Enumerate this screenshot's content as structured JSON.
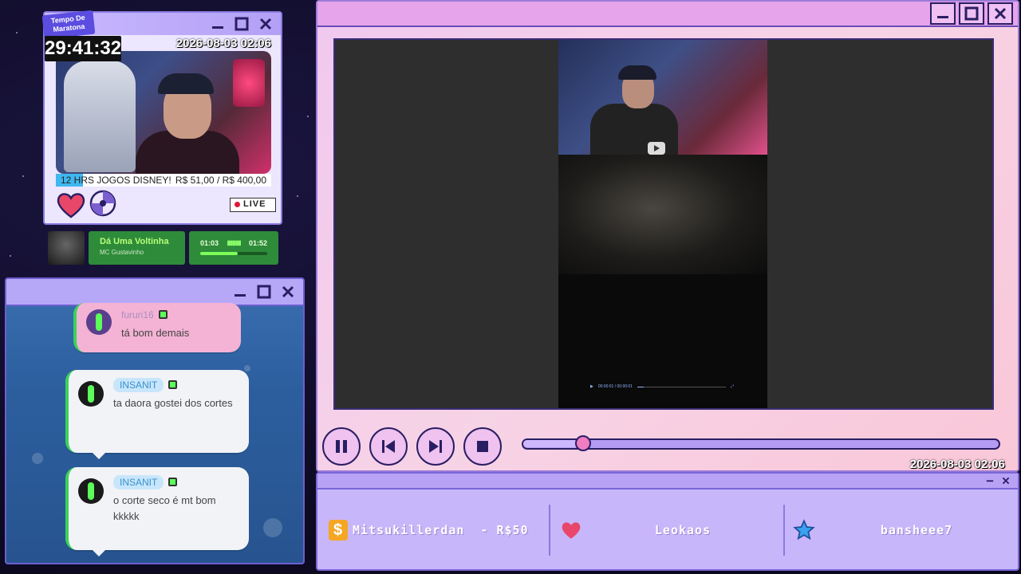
{
  "webcam": {
    "marathon_label": "Tempo De Maratona",
    "marathon_time": "29:41:32",
    "datetime": "2026-08-03 02:06",
    "goal_title": "12 HRS JOGOS DISNEY!",
    "goal_amount": "R$ 51,00 / R$ 400,00",
    "goal_progress": 0.1275,
    "live_label": "LIVE"
  },
  "music": {
    "title": "Dá Uma Voltinha",
    "artist": "MC Gustavinho",
    "current_time": "01:03",
    "total_time": "01:52",
    "progress": 0.56
  },
  "chat": {
    "messages": [
      {
        "user": "fururi16",
        "text": "tá bom demais",
        "style": "pink"
      },
      {
        "user": "INSANIT",
        "text": "ta daora gostei dos cortes",
        "style": "white"
      },
      {
        "user": "INSANIT",
        "text": "o corte seco é mt bom kkkkk",
        "style": "white"
      }
    ]
  },
  "player": {
    "datetime": "2026-08-03 02:06",
    "seek_progress": 0.125,
    "clip_time": "00:00:01 / 00:00:01"
  },
  "alerts": {
    "donation_user": "Mitsukillerdan",
    "donation_amount": "- R$50",
    "follower": "Leokaos",
    "subscriber": "bansheee7"
  },
  "colors": {
    "accent": "#b49cf5",
    "pink": "#f07cc2",
    "chat_green": "#39d35a",
    "music_green": "#2e8b3a"
  }
}
